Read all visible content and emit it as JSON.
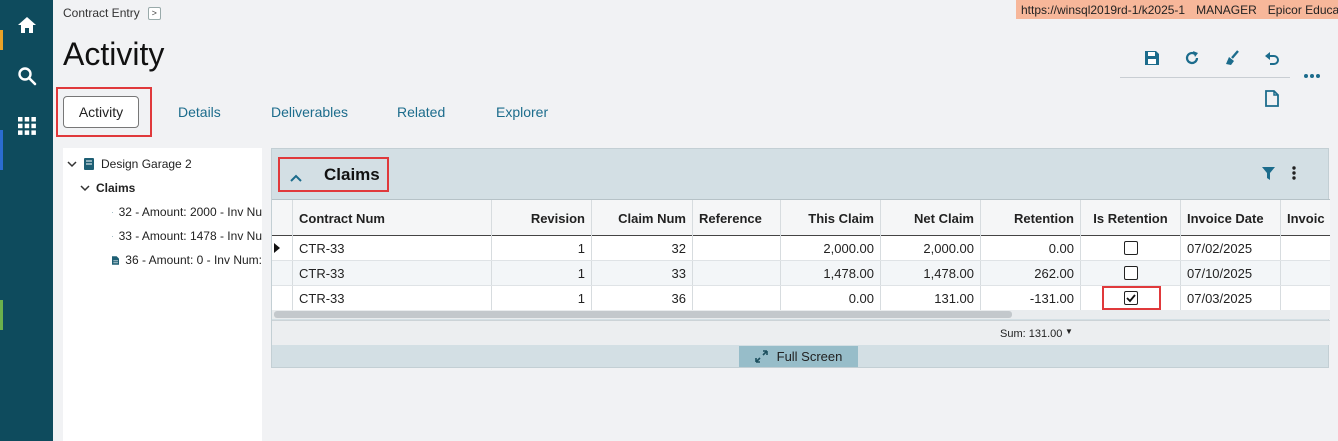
{
  "breadcrumb": {
    "label": "Contract Entry",
    "chevron": ">"
  },
  "env": {
    "url": "https://winsql2019rd-1/k2025-1",
    "user": "MANAGER",
    "company": "Epicor Education"
  },
  "page_title": "Activity",
  "tabs": [
    {
      "label": "Activity"
    },
    {
      "label": "Details"
    },
    {
      "label": "Deliverables"
    },
    {
      "label": "Related"
    },
    {
      "label": "Explorer"
    }
  ],
  "tree": {
    "root": "Design Garage 2",
    "group": "Claims",
    "items": [
      "32 - Amount: 2000 - Inv Nu",
      "33 - Amount: 1478 - Inv Nu",
      "36 - Amount: 0 - Inv Num:"
    ]
  },
  "panel": {
    "title": "Claims"
  },
  "grid": {
    "columns": [
      "Contract Num",
      "Revision",
      "Claim Num",
      "Reference",
      "This Claim",
      "Net Claim",
      "Retention",
      "Is Retention",
      "Invoice Date",
      "Invoic"
    ],
    "rows": [
      {
        "contract": "CTR-33",
        "revision": "1",
        "claim": "32",
        "reference": "",
        "this_claim": "2,000.00",
        "net_claim": "2,000.00",
        "retention": "0.00",
        "is_retention": false,
        "invoice_date": "07/02/2025"
      },
      {
        "contract": "CTR-33",
        "revision": "1",
        "claim": "33",
        "reference": "",
        "this_claim": "1,478.00",
        "net_claim": "1,478.00",
        "retention": "262.00",
        "is_retention": false,
        "invoice_date": "07/10/2025"
      },
      {
        "contract": "CTR-33",
        "revision": "1",
        "claim": "36",
        "reference": "",
        "this_claim": "0.00",
        "net_claim": "131.00",
        "retention": "-131.00",
        "is_retention": true,
        "invoice_date": "07/03/2025"
      }
    ],
    "sum": "Sum: 131.00",
    "full_screen": "Full Screen"
  },
  "colors": {
    "nav": "#0e4b5d",
    "accent": "#1c6c8c",
    "highlight": "#e0393b",
    "env_bg": "#f7b79a"
  }
}
